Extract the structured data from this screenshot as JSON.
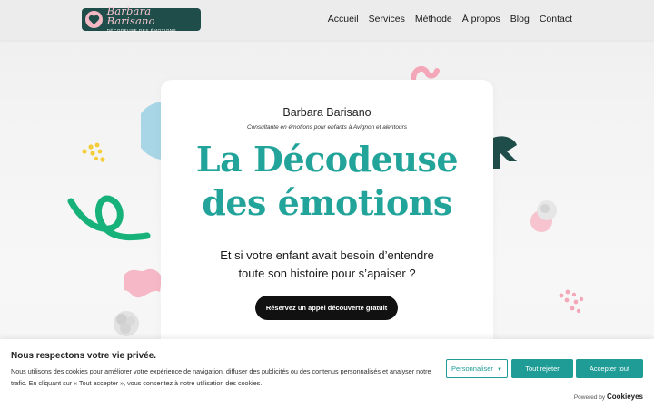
{
  "header": {
    "logo": {
      "name": "Barbara Barisano",
      "subtitle": "DÉCODEUSE DES ÉMOTIONS"
    },
    "nav": [
      "Accueil",
      "Services",
      "Méthode",
      "À propos",
      "Blog",
      "Contact"
    ]
  },
  "hero": {
    "name": "Barbara Barisano",
    "tagline": "Consultante en émotions pour enfants à Avignon et alentours",
    "title_line1": "La Décodeuse",
    "title_line2": "des émotions",
    "question_line1": "Et si votre enfant avait besoin d’entendre",
    "question_line2": "toute son histoire pour s’apaiser ?",
    "cta": "Réservez un appel découverte gratuit"
  },
  "cookie_banner": {
    "title": "Nous respectons votre vie privée.",
    "text": "Nous utilisons des cookies pour améliorer votre expérience de navigation, diffuser des publicités ou des contenus personnalisés et analyser notre trafic. En cliquant sur « Tout accepter », vous consentez à notre utilisation des cookies.",
    "customize": "Personnaliser",
    "reject": "Tout rejeter",
    "accept": "Accepter tout",
    "powered_by": "Powered by",
    "powered_brand": "Cookieyes"
  },
  "colors": {
    "accent": "#23a49b",
    "logo_bg": "#1f4d4a",
    "pink": "#f6b8c6",
    "green": "#17b27a",
    "blue": "#1d72e0",
    "yellow": "#f5cd3b"
  },
  "icons": [
    "chevron-down-icon"
  ]
}
